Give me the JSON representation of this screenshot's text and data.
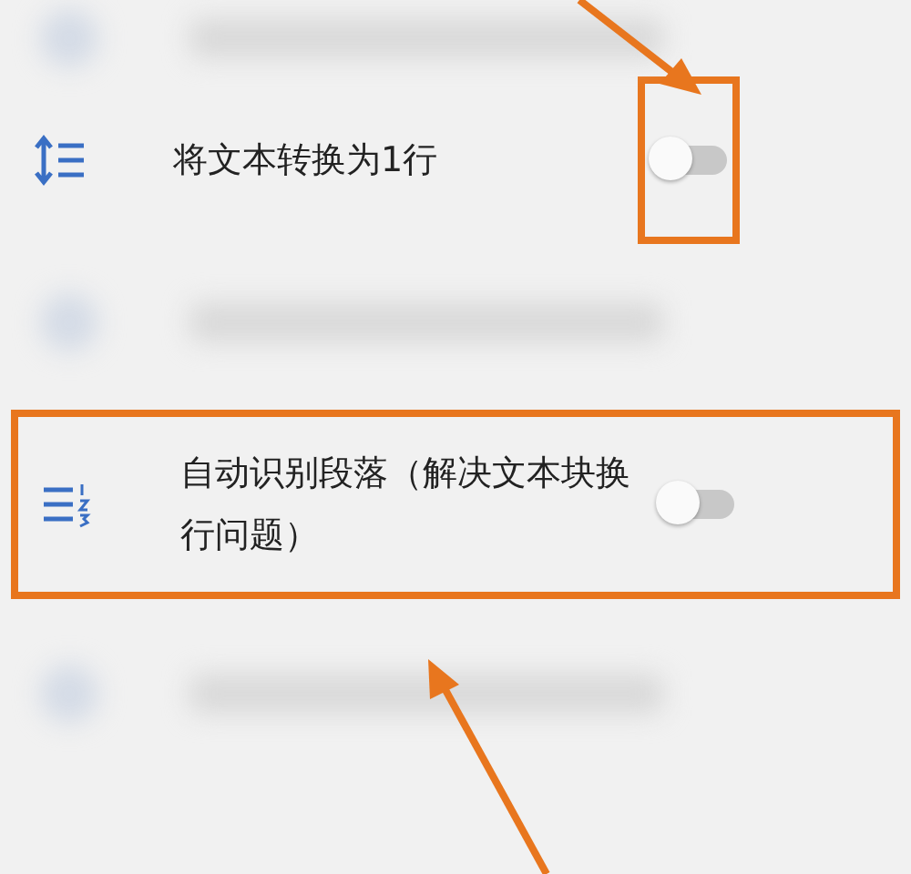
{
  "settings": [
    {
      "kind": "blurred"
    },
    {
      "kind": "single-line-setting",
      "label": "将文本转换为1行",
      "on": false,
      "toggle_highlighted": true,
      "row_highlighted": false
    },
    {
      "kind": "blurred"
    },
    {
      "kind": "paragraph-setting",
      "label": "自动识别段落（解决文本块换行问题）",
      "on": false,
      "toggle_highlighted": false,
      "row_highlighted": true
    },
    {
      "kind": "blurred"
    }
  ]
}
